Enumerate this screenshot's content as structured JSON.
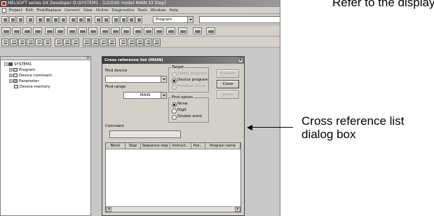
{
  "window": {
    "title": "MELSOFT series GX Developer D:\\SYSTEM1 - [LD(Edit mode)   MAIN   33 Step]"
  },
  "menubar": {
    "items": [
      "Project",
      "Edit",
      "Find/Replace",
      "Convert",
      "View",
      "Online",
      "Diagnostics",
      "Tools",
      "Window",
      "Help"
    ]
  },
  "toolbar": {
    "data_type_select": "Program"
  },
  "function_keys": {
    "labels": [
      "F5",
      "sF5",
      "F6",
      "sF6",
      "F7",
      "F8",
      "F9",
      "sF9",
      "aF9",
      "sF7",
      "sF8",
      "aF7",
      "aF8",
      "F5",
      "aF5",
      "caF5",
      "F10",
      "aF9"
    ]
  },
  "project_tree": {
    "root": "SYSTEM1",
    "items": [
      "Program",
      "Device comment",
      "Parameter",
      "Device memory"
    ]
  },
  "dialog": {
    "title": "Cross reference list (MAIN)",
    "close_glyph": "×",
    "find_device_label": "Find device",
    "find_device_value": "",
    "find_range_label": "Find range",
    "find_range_value": "MAIN",
    "target_group": "Target",
    "target_options": [
      "Select program",
      "Device program",
      "Function block"
    ],
    "target_selected": "Device program",
    "find_option_group": "Find option",
    "find_options": [
      "None",
      "Digit",
      "Double word"
    ],
    "find_option_selected": "None",
    "comment_label": "Comment",
    "comment_value": "",
    "buttons": {
      "execute": "Execute",
      "close": "Close",
      "jump": "Jump"
    },
    "table_columns": [
      "Block",
      "Step",
      "Sequence step",
      "Instruct...",
      "Pos...",
      "Program name"
    ]
  },
  "annotation": {
    "line1": "Cross reference list",
    "line2": "dialog box",
    "top_cut_text": "Refer to the display"
  }
}
